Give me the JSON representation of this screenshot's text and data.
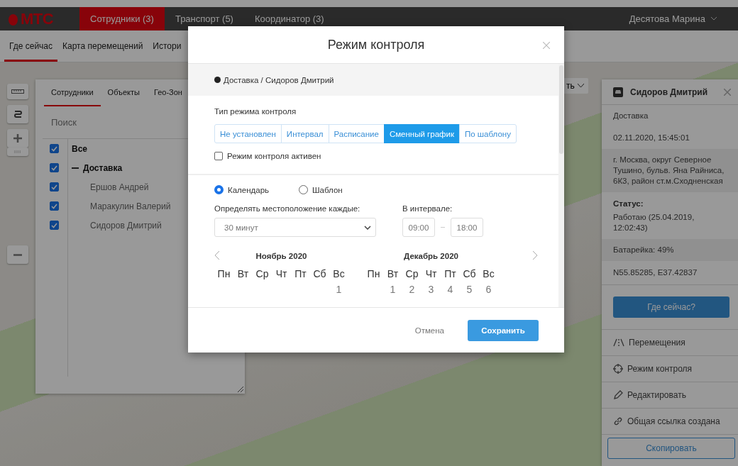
{
  "top_bar": {
    "logo": "МТС",
    "tabs": [
      {
        "label": "Сотрудники (3)",
        "selected": true
      },
      {
        "label": "Транспорт (5)",
        "selected": false
      },
      {
        "label": "Координатор (3)",
        "selected": false
      }
    ],
    "user": "Десятова Марина"
  },
  "sub_nav": [
    {
      "label": "Где сейчас",
      "selected": true
    },
    {
      "label": "Карта перемещений",
      "selected": false
    },
    {
      "label": "Истори",
      "selected": false
    }
  ],
  "left_panel": {
    "tabs": [
      {
        "label": "Сотрудники",
        "selected": true
      },
      {
        "label": "Объекты",
        "selected": false
      },
      {
        "label": "Гео-Зон",
        "selected": false
      }
    ],
    "search": {
      "placeholder": "Поиск"
    },
    "tree": [
      {
        "label": "Все",
        "checked": true,
        "children": [
          {
            "label": "Доставка",
            "checked": true,
            "expanded": true,
            "children": [
              {
                "label": "Ершов Андрей",
                "checked": true
              },
              {
                "label": "Маракулин Валерий",
                "checked": true
              },
              {
                "label": "Сидоров Дмитрий",
                "checked": true
              }
            ]
          }
        ]
      }
    ]
  },
  "map_dropdown": "ть",
  "right_panel": {
    "title": "Сидоров Дмитрий",
    "group": "Доставка",
    "time": "02.11.2020, 15:45:01",
    "address": "г. Москва, округ Северное Тушино, бульв. Яна Райниса, 6К3, район ст.м.Сходненская",
    "status_label": "Статус:",
    "status_value": "Работаю (25.04.2019, 12:02:43)",
    "battery": "Батарейка: 49%",
    "coords": "N55.85285, E37.42837",
    "locate_button": "Где сейчас?",
    "actions": [
      {
        "kind": "tracks",
        "label": "Перемещения"
      },
      {
        "kind": "control",
        "label": "Режим контроля"
      },
      {
        "kind": "edit",
        "label": "Редактировать"
      },
      {
        "kind": "share",
        "label": "Общая ссылка создана"
      }
    ],
    "copy_button": "Скопировать"
  },
  "modal": {
    "title": "Режим контроля",
    "subject": "Доставка / Сидоров Дмитрий",
    "type_label": "Тип режима контроля",
    "modes": [
      {
        "label": "Не установлен",
        "selected": false
      },
      {
        "label": "Интервал",
        "selected": false
      },
      {
        "label": "Расписание",
        "selected": false
      },
      {
        "label": "Сменный график",
        "selected": true
      },
      {
        "label": "По шаблону",
        "selected": false
      }
    ],
    "active_checkbox": {
      "label": "Режим контроля активен",
      "checked": false
    },
    "sources": [
      {
        "label": "Календарь",
        "selected": true
      },
      {
        "label": "Шаблон",
        "selected": false
      }
    ],
    "interval_label": "Определять местоположение каждые:",
    "interval_value": "30 минут",
    "range_label": "В интервале:",
    "range_from": "09:00",
    "range_to": "18:00",
    "months": [
      {
        "title": "Ноябрь 2020",
        "weekdays": [
          {
            "label": "Пн"
          },
          {
            "label": "Вт"
          },
          {
            "label": "Ср"
          },
          {
            "label": "Чт"
          },
          {
            "label": "Пт"
          },
          {
            "label": "Сб"
          },
          {
            "label": "Вс",
            "day": "1"
          }
        ]
      },
      {
        "title": "Декабрь 2020",
        "weekdays": [
          {
            "label": "Пн"
          },
          {
            "label": "Вт",
            "day": "1"
          },
          {
            "label": "Ср",
            "day": "2"
          },
          {
            "label": "Чт",
            "day": "3"
          },
          {
            "label": "Пт",
            "day": "4"
          },
          {
            "label": "Сб",
            "day": "5"
          },
          {
            "label": "Вс",
            "day": "6"
          }
        ]
      }
    ],
    "cancel_button": "Отмена",
    "save_button": "Сохранить"
  }
}
